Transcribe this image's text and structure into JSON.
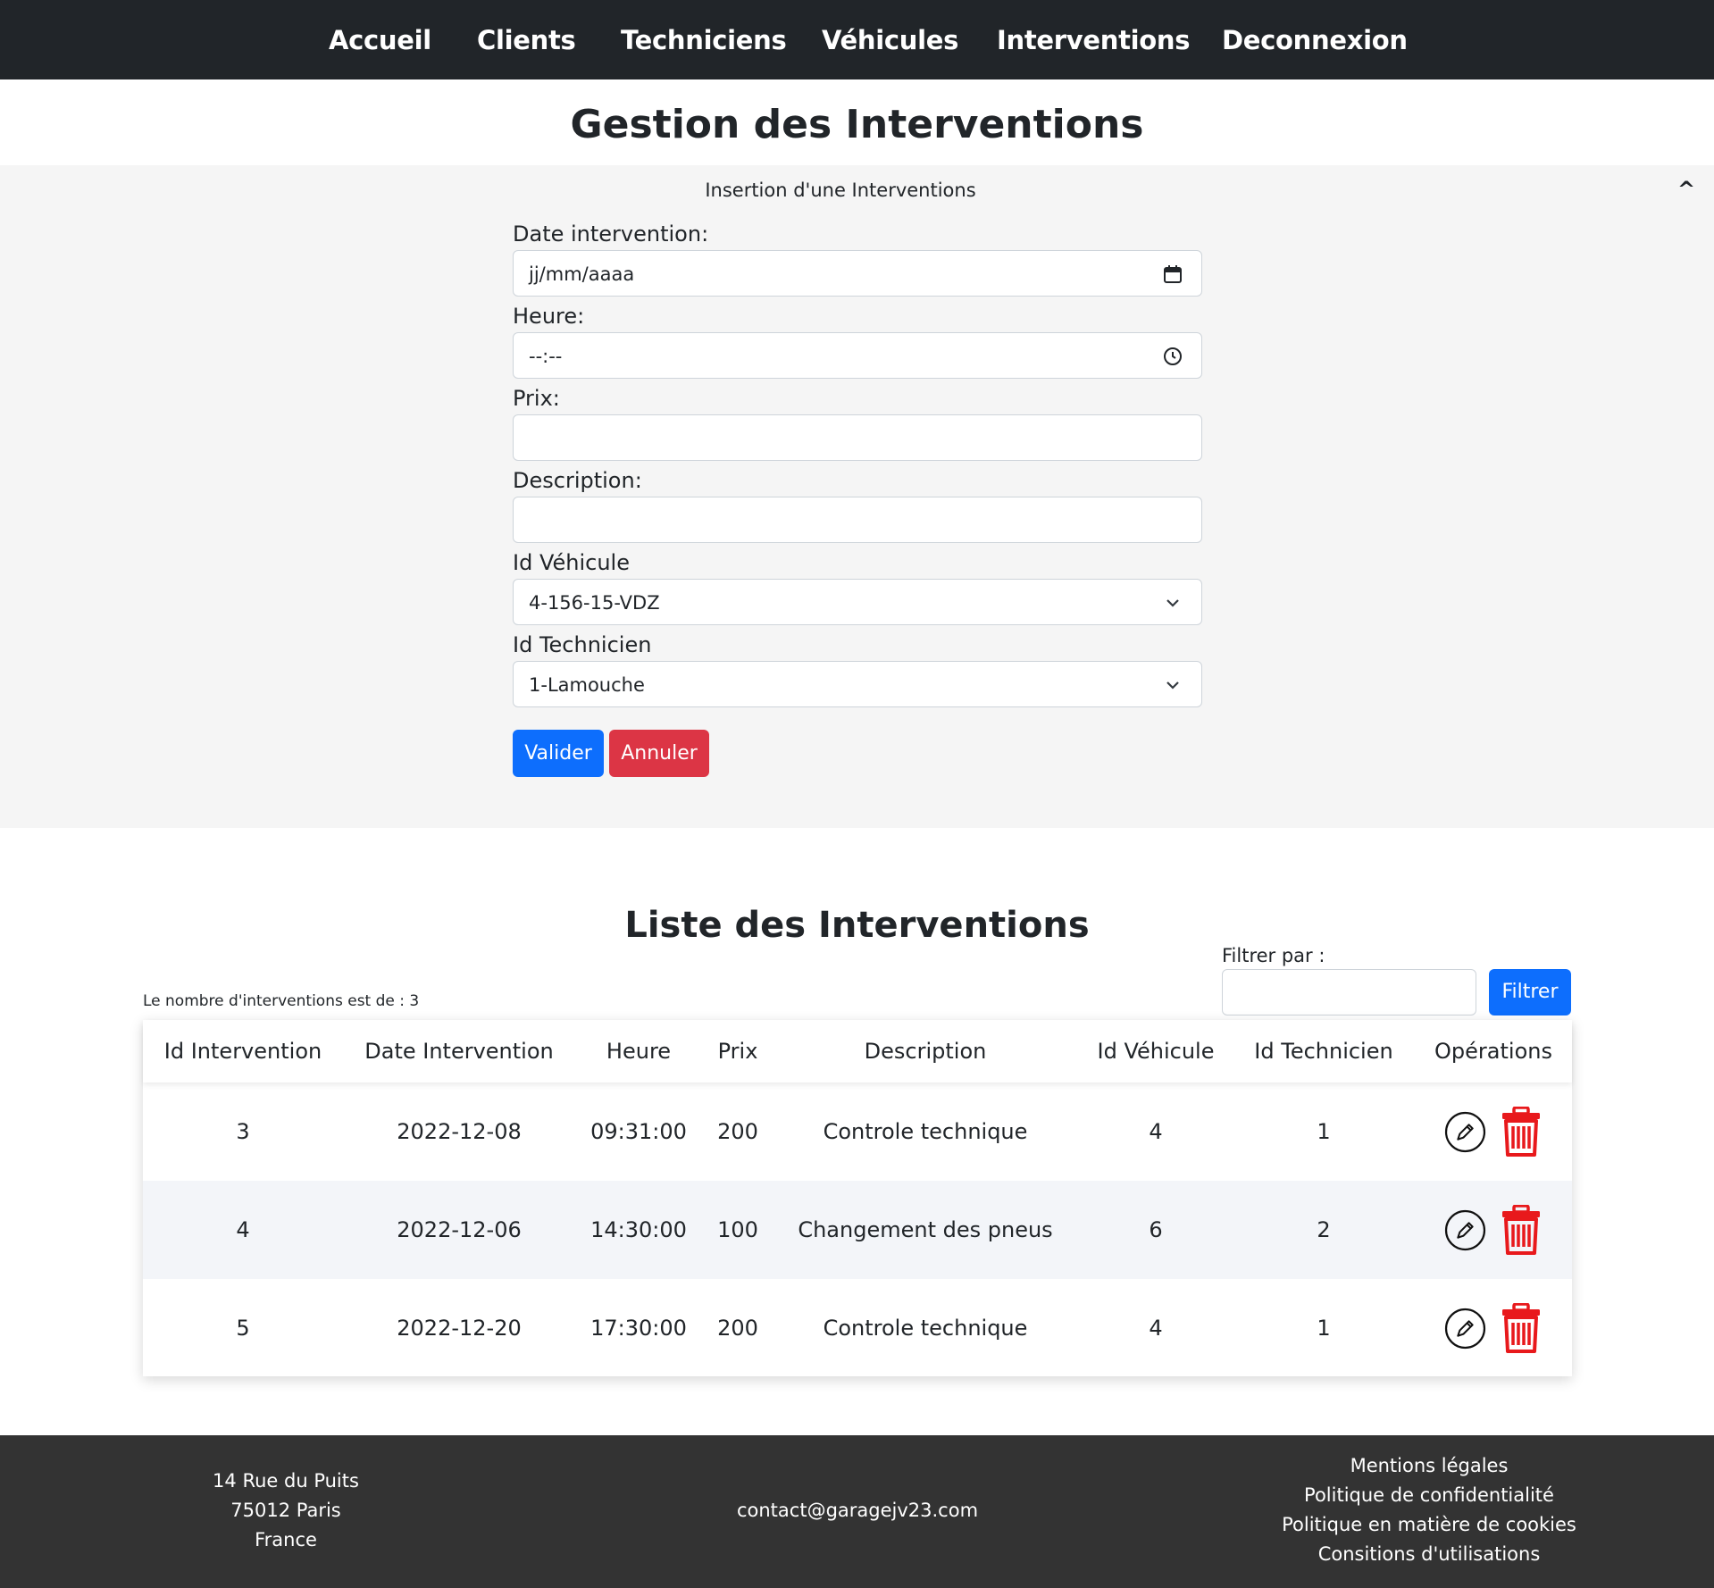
{
  "nav": {
    "items": [
      "Accueil",
      "Clients",
      "Techniciens",
      "Véhicules",
      "Interventions",
      "Deconnexion"
    ]
  },
  "page_title": "Gestion des Interventions",
  "form": {
    "panel_title": "Insertion d'une Interventions",
    "collapse_symbol": "^",
    "date": {
      "label": "Date intervention:",
      "placeholder": "jj/mm/aaaa"
    },
    "heure": {
      "label": "Heure:",
      "placeholder": "--:--"
    },
    "prix": {
      "label": "Prix:",
      "value": ""
    },
    "description": {
      "label": "Description:",
      "value": ""
    },
    "vehicule": {
      "label": "Id Véhicule",
      "selected": "4-156-15-VDZ"
    },
    "technicien": {
      "label": "Id Technicien",
      "selected": "1-Lamouche"
    },
    "valider_label": "Valider",
    "annuler_label": "Annuler"
  },
  "list": {
    "title": "Liste des Interventions",
    "count_text": "Le nombre d'interventions est de : 3",
    "filter_label": "Filtrer par :",
    "filter_value": "",
    "filter_button": "Filtrer",
    "columns": [
      "Id Intervention",
      "Date Intervention",
      "Heure",
      "Prix",
      "Description",
      "Id Véhicule",
      "Id Technicien",
      "Opérations"
    ],
    "rows": [
      {
        "id": "3",
        "date": "2022-12-08",
        "heure": "09:31:00",
        "prix": "200",
        "description": "Controle technique",
        "vehicule": "4",
        "technicien": "1"
      },
      {
        "id": "4",
        "date": "2022-12-06",
        "heure": "14:30:00",
        "prix": "100",
        "description": "Changement des pneus",
        "vehicule": "6",
        "technicien": "2"
      },
      {
        "id": "5",
        "date": "2022-12-20",
        "heure": "17:30:00",
        "prix": "200",
        "description": "Controle technique",
        "vehicule": "4",
        "technicien": "1"
      }
    ],
    "icons": {
      "edit": "pencil-circle-icon",
      "delete": "trash-icon"
    }
  },
  "footer": {
    "address": [
      "14 Rue du Puits",
      "75012 Paris",
      "France"
    ],
    "email": "contact@garagejv23.com",
    "links": [
      "Mentions légales",
      "Politique de confidentialité",
      "Politique en matière de cookies",
      "Consitions d'utilisations"
    ]
  },
  "colors": {
    "nav_bg": "#212529",
    "form_bg": "#f5f5f5",
    "primary": "#0d6efd",
    "danger": "#dc3545",
    "delete_icon": "#e8191c",
    "footer_bg": "#333333"
  }
}
